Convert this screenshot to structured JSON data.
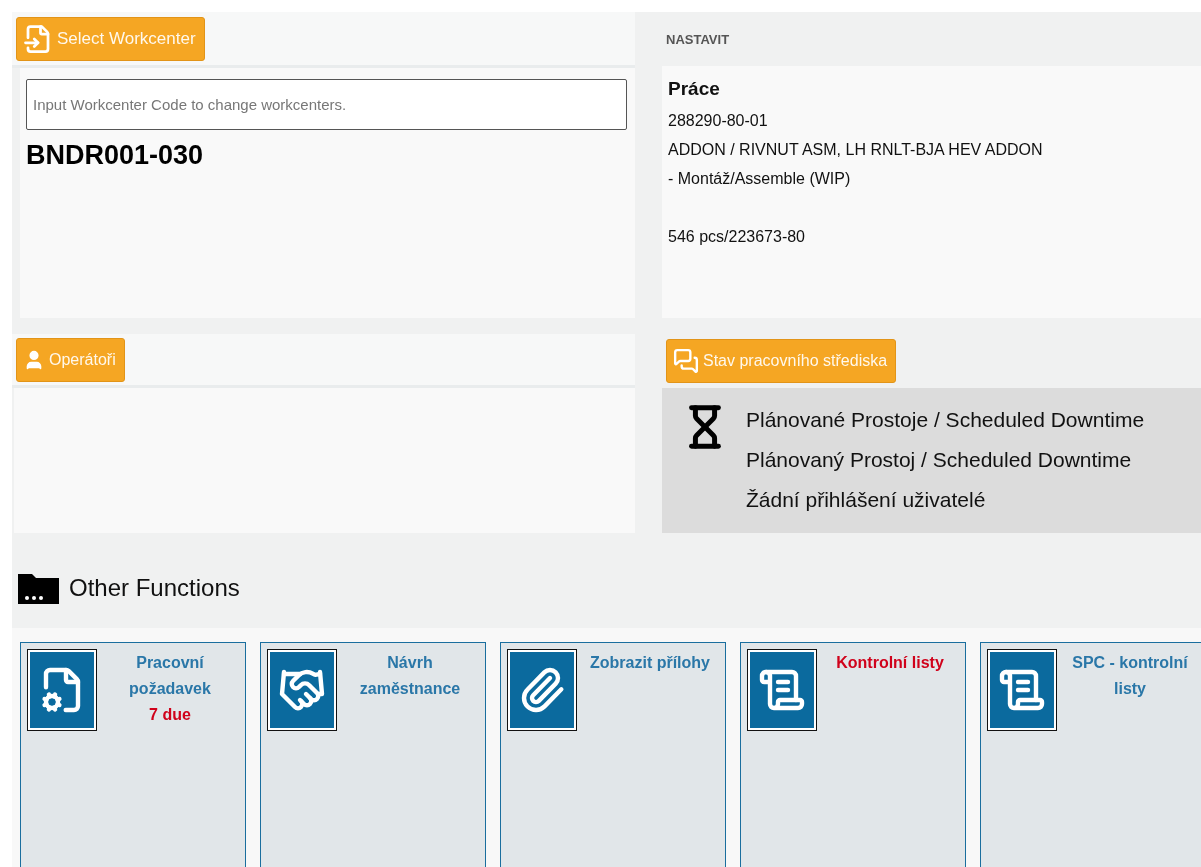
{
  "workcenter": {
    "button": "Select Workcenter",
    "input": {
      "placeholder": "Input Workcenter Code to change workcenters."
    },
    "code": "BNDR001-030"
  },
  "setup": {
    "heading": "NASTAVIT",
    "title": "Práce",
    "lines": [
      "288290-80-01",
      "ADDON / RIVNUT ASM, LH RNLT-BJA HEV ADDON",
      "- Montáž/Assemble (WIP)"
    ],
    "quantity": "546 pcs/223673-80"
  },
  "operators": {
    "button": "Operátoři"
  },
  "status": {
    "button": "Stav pracovního střediska",
    "lines": [
      "Plánované Prostoje / Scheduled Downtime",
      "Plánovaný Prostoj / Scheduled Downtime",
      "Žádní přihlášení uživatelé"
    ]
  },
  "other_functions": {
    "title": "Other Functions",
    "tiles": [
      {
        "kind": "work-request",
        "title": "Pracovní požadavek",
        "alert": false,
        "due": "7 due"
      },
      {
        "kind": "employee",
        "title": "Návrh zaměstnance",
        "alert": false
      },
      {
        "kind": "attachments",
        "title": "Zobrazit přílohy",
        "alert": false
      },
      {
        "kind": "checklist",
        "title": "Kontrolní listy",
        "alert": true
      },
      {
        "kind": "checklist",
        "title": "SPC - kontrolní listy",
        "alert": false
      }
    ]
  }
}
